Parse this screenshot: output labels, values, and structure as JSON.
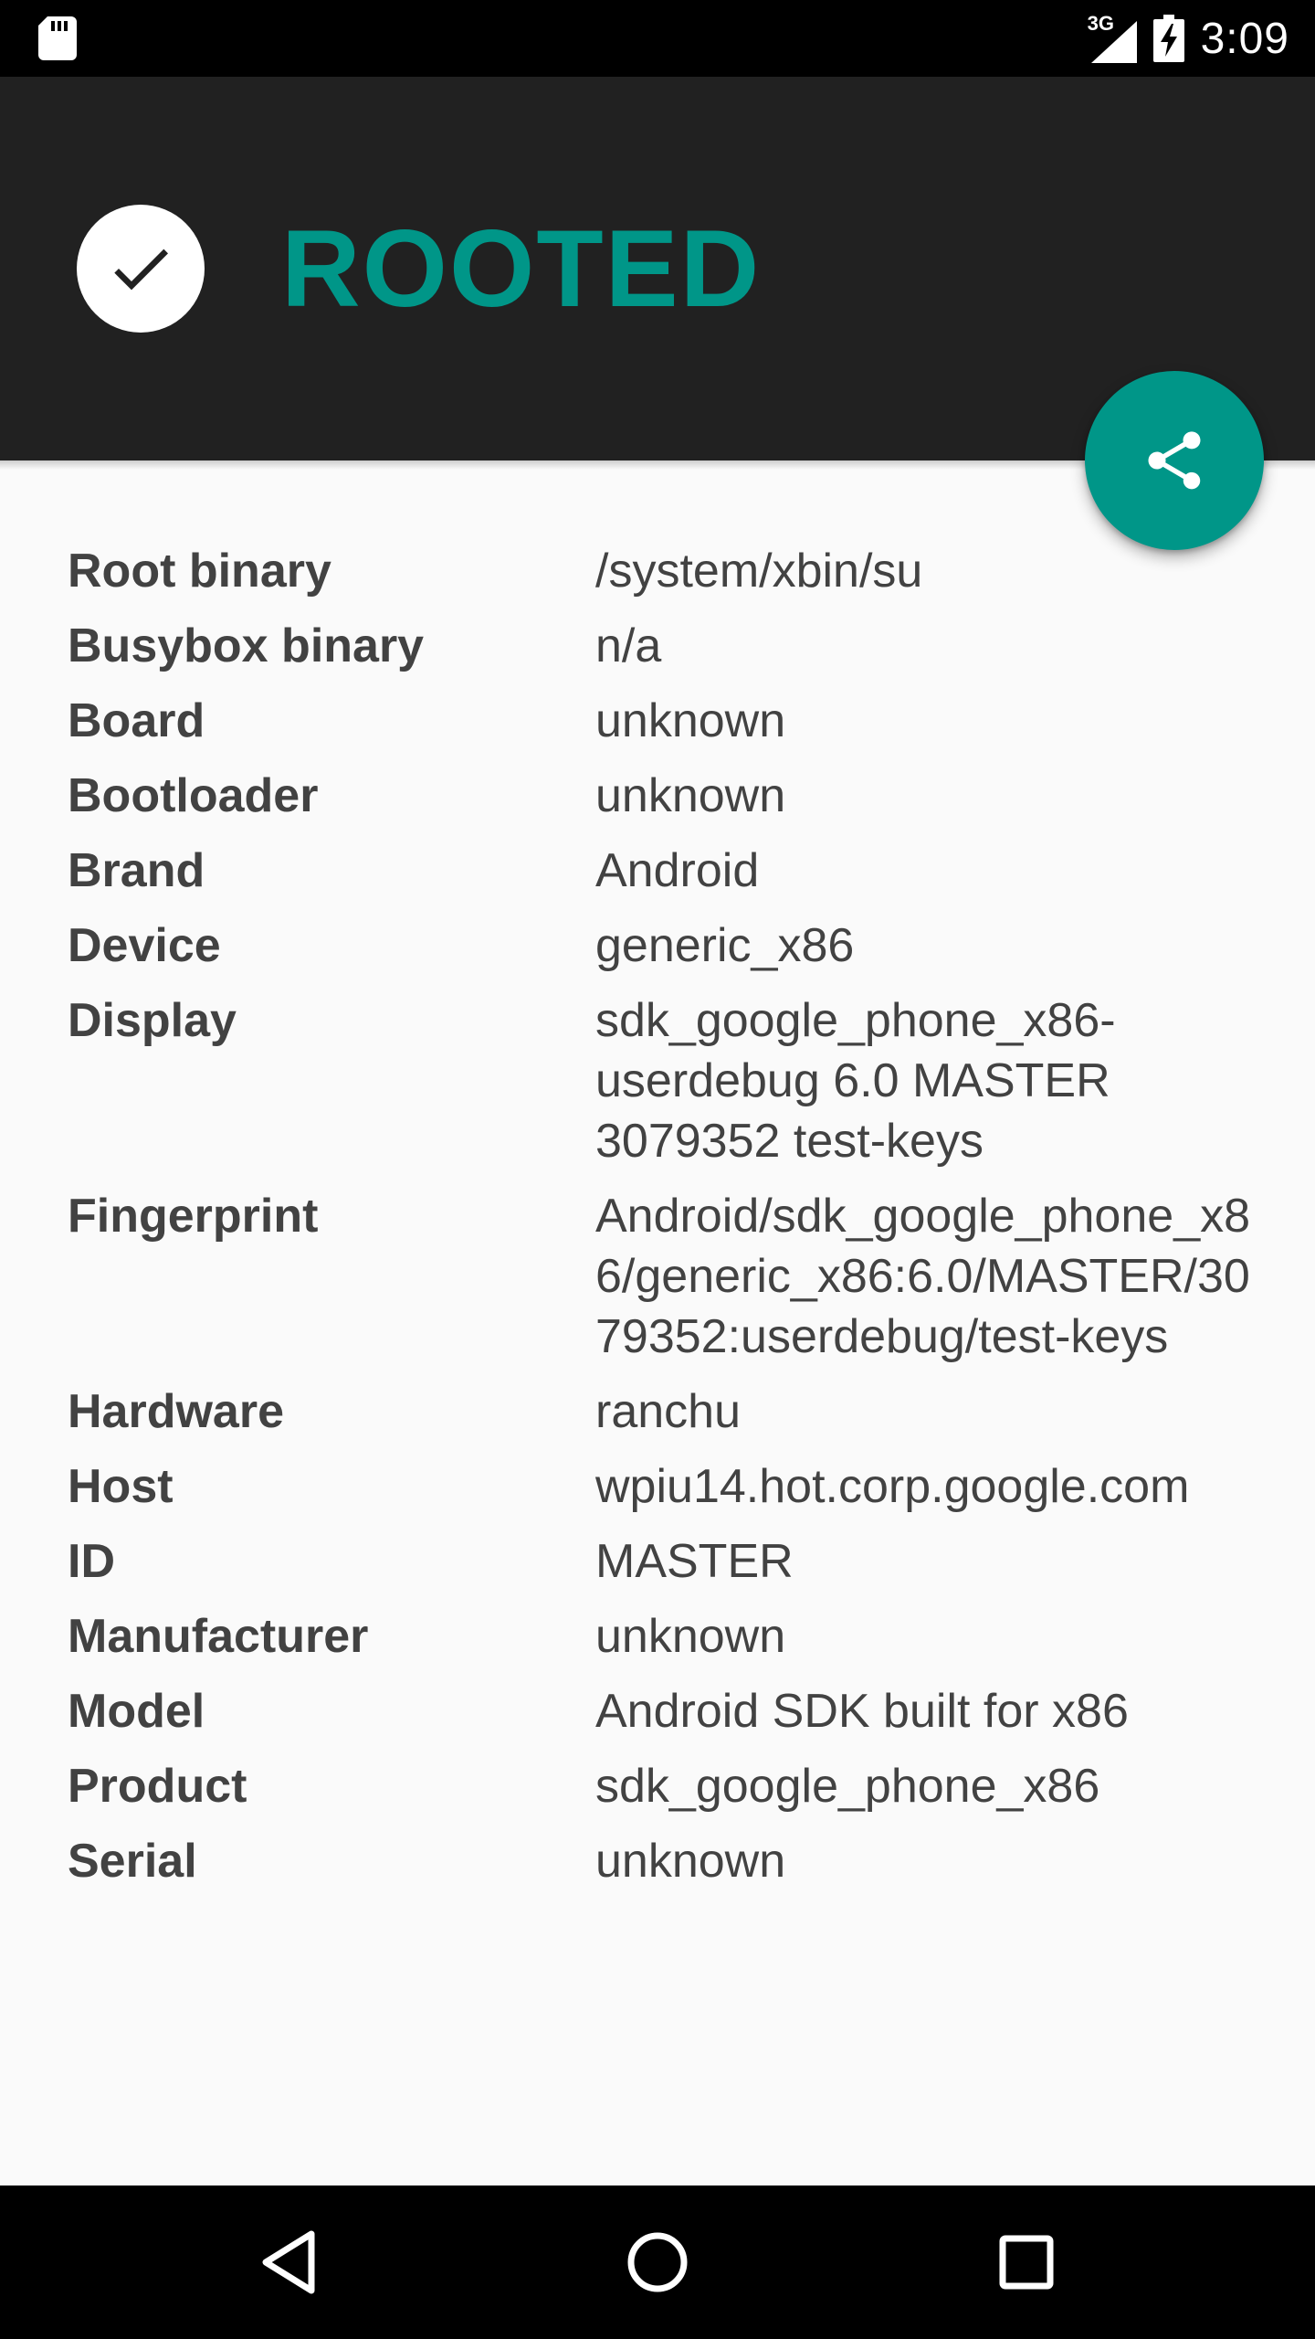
{
  "status_bar": {
    "network_type": "3G",
    "time": "3:09",
    "icons": [
      "sd-card-icon",
      "signal-icon",
      "battery-charging-icon"
    ]
  },
  "header": {
    "status_text": "ROOTED",
    "status_icon": "check-icon",
    "accent_color": "#009688",
    "background_color": "#212121"
  },
  "fab": {
    "icon": "share-icon"
  },
  "info": [
    {
      "label": "Root binary",
      "value": "/system/xbin/su"
    },
    {
      "label": "Busybox binary",
      "value": "n/a"
    },
    {
      "label": "Board",
      "value": "unknown"
    },
    {
      "label": "Bootloader",
      "value": "unknown"
    },
    {
      "label": "Brand",
      "value": "Android"
    },
    {
      "label": "Device",
      "value": "generic_x86"
    },
    {
      "label": "Display",
      "value": "sdk_google_phone_x86-userdebug 6.0 MASTER 3079352 test-keys"
    },
    {
      "label": "Fingerprint",
      "value": "Android/sdk_google_phone_x86/generic_x86:6.0/MASTER/3079352:userdebug/test-keys"
    },
    {
      "label": "Hardware",
      "value": "ranchu"
    },
    {
      "label": "Host",
      "value": "wpiu14.hot.corp.google.com"
    },
    {
      "label": "ID",
      "value": "MASTER"
    },
    {
      "label": "Manufacturer",
      "value": "unknown"
    },
    {
      "label": "Model",
      "value": "Android SDK built for x86"
    },
    {
      "label": "Product",
      "value": "sdk_google_phone_x86"
    },
    {
      "label": "Serial",
      "value": "unknown"
    }
  ],
  "nav_bar": {
    "buttons": [
      "back-icon",
      "home-icon",
      "recents-icon"
    ]
  }
}
